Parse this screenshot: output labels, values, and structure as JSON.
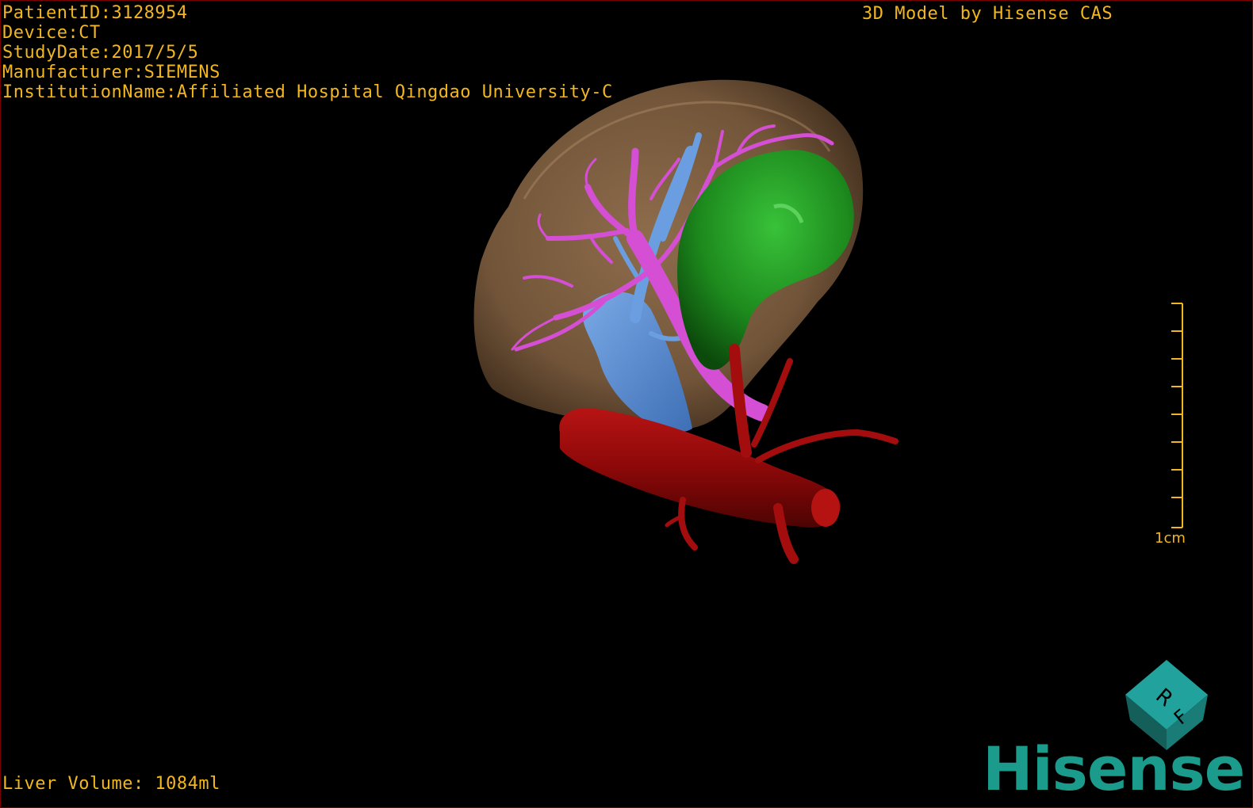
{
  "patient_info": {
    "patient_id": "PatientID:3128954",
    "device": "Device:CT",
    "study_date": "StudyDate:2017/5/5",
    "manufacturer": "Manufacturer:SIEMENS",
    "institution": "InstitutionName:Affiliated Hospital Qingdao University-C"
  },
  "credit": "3D Model by Hisense CAS",
  "liver_volume": "Liver Volume: 1084ml",
  "scale_bar": {
    "label": "1cm"
  },
  "orientation_cube": {
    "face_top": "R",
    "face_front": "F"
  },
  "logo": "Hisense",
  "colors": {
    "text": "#f2b61e",
    "liver": "#8c6a4a",
    "tumor": "#1e8a1e",
    "portal_vein": "#d44fd4",
    "hepatic_vein": "#5b8fd6",
    "artery": "#9b0a0a",
    "logo": "#1b9b8c",
    "cube": "#1e8a86"
  },
  "model_structures": [
    "liver",
    "tumor",
    "portal-vein",
    "hepatic-vein",
    "aorta-artery"
  ]
}
